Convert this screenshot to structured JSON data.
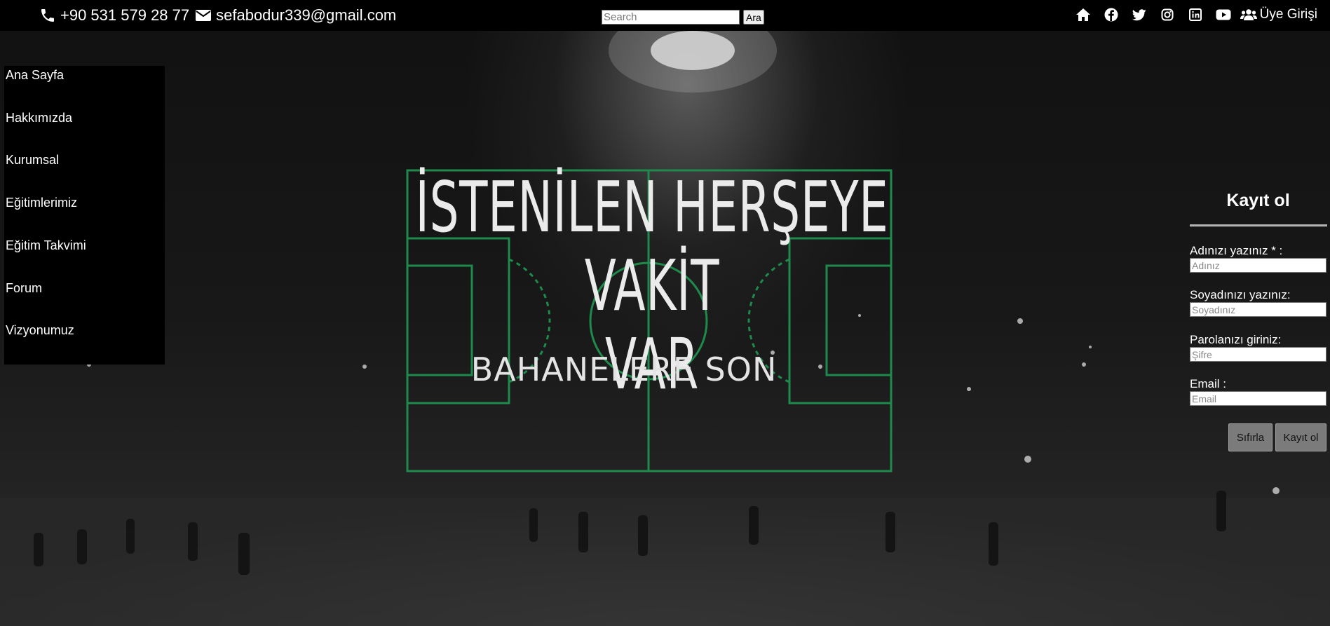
{
  "topbar": {
    "phone": "+90 531 579 28 77",
    "email": "sefabodur339@gmail.com",
    "search_placeholder": "Search",
    "search_button": "Ara",
    "member_login": "Üye Girişi",
    "icons": [
      "phone-icon",
      "envelope-icon",
      "home-icon",
      "facebook-icon",
      "twitter-icon",
      "instagram-icon",
      "linkedin-icon",
      "youtube-icon",
      "users-icon"
    ]
  },
  "sidebar": {
    "items": [
      {
        "label": "Ana Sayfa"
      },
      {
        "label": "Hakkımızda"
      },
      {
        "label": "Kurumsal"
      },
      {
        "label": "Eğitimlerimiz"
      },
      {
        "label": "Eğitim Takvimi"
      },
      {
        "label": "Forum"
      },
      {
        "label": "Vizyonumuz"
      }
    ]
  },
  "hero": {
    "title_line1": "İSTENİLEN HERŞEYE VAKİT",
    "title_line2": "VAR",
    "subtitle": "BAHANELERE SON"
  },
  "register": {
    "title": "Kayıt ol",
    "fields": [
      {
        "label": "Adınızı yazınız * :",
        "placeholder": "Adınız"
      },
      {
        "label": "Soyadınızı yazınız:",
        "placeholder": "Soyadınız"
      },
      {
        "label": "Parolanızı giriniz:",
        "placeholder": "Şifre"
      },
      {
        "label": "Email :",
        "placeholder": "Email"
      }
    ],
    "reset_button": "Sıfırla",
    "submit_button": "Kayıt ol"
  },
  "colors": {
    "topbar_bg": "#000000",
    "pitch_lines": "#1e8a4c",
    "button_bg": "#7b7b7b"
  }
}
